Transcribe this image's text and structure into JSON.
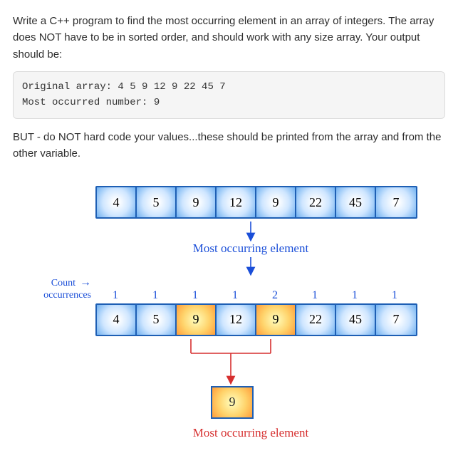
{
  "prompt": {
    "p1": "Write a C++ program to find the most occurring element in an array of integers. The array does NOT have to be in sorted order, and should work with any size array. Your output should be:",
    "code_line1": "Original array: 4 5 9 12 9 22 45 7",
    "code_line2": "Most occurred number: 9",
    "p2": "BUT - do NOT hard code your values...these should be printed from the array and from the other variable."
  },
  "labels": {
    "most_occurring": "Most occurring element",
    "count_line1": "Count",
    "count_line2": "occurrences",
    "result_caption": "Most occurring element"
  },
  "chart_data": {
    "type": "table",
    "array": [
      4,
      5,
      9,
      12,
      9,
      22,
      45,
      7
    ],
    "counts": [
      1,
      1,
      1,
      1,
      2,
      1,
      1,
      1
    ],
    "highlight_indices": [
      2,
      4
    ],
    "result": 9
  }
}
